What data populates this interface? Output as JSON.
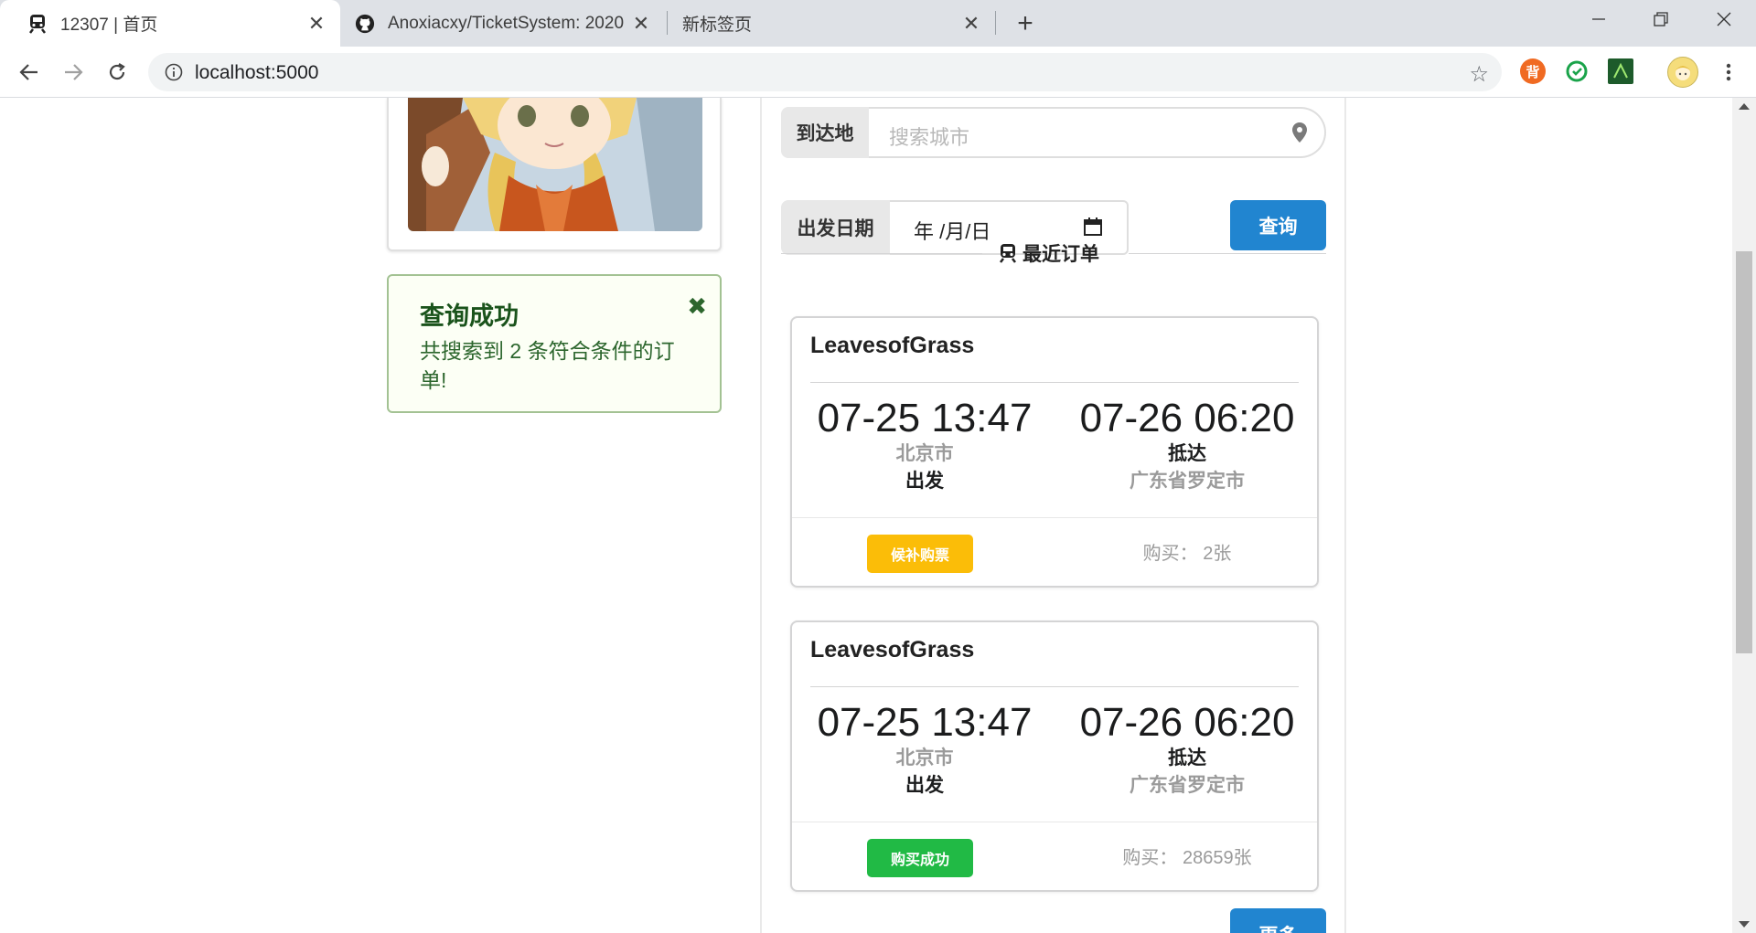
{
  "browser": {
    "tabs": [
      {
        "title": "12307 | 首页",
        "icon": "train-icon",
        "active": true
      },
      {
        "title": "Anoxiacxy/TicketSystem: 2020",
        "icon": "github-icon",
        "active": false
      },
      {
        "title": "新标签页",
        "icon": "",
        "active": false
      }
    ],
    "url": "localhost:5000",
    "extensions": [
      "背",
      "sync",
      "terminal"
    ]
  },
  "page": {
    "alert": {
      "title": "查询成功",
      "message": "共搜索到 2 条符合条件的订单!"
    },
    "search": {
      "arrival_label": "到达地",
      "arrival_placeholder": "搜索城市",
      "date_label": "出发日期",
      "date_value": "年 /月/日",
      "query_button": "查询"
    },
    "recent_orders_title": "最近订单",
    "orders": [
      {
        "train": "LeavesofGrass",
        "depart_time": "07-25 13:47",
        "depart_city": "北京市",
        "depart_label": "出发",
        "arrive_time": "07-26 06:20",
        "arrive_label": "抵达",
        "arrive_city": "广东省罗定市",
        "status": "候补购票",
        "status_color": "#fbbd08",
        "quantity": "购买： 2张"
      },
      {
        "train": "LeavesofGrass",
        "depart_time": "07-25 13:47",
        "depart_city": "北京市",
        "depart_label": "出发",
        "arrive_time": "07-26 06:20",
        "arrive_label": "抵达",
        "arrive_city": "广东省罗定市",
        "status": "购买成功",
        "status_color": "#21ba45",
        "quantity": "购买： 28659张"
      }
    ],
    "more_button": "更多"
  },
  "colors": {
    "primary": "#2185d0",
    "success_bg": "#fcfff5",
    "success_text": "#2c662d",
    "warning": "#fbbd08",
    "green": "#21ba45"
  }
}
